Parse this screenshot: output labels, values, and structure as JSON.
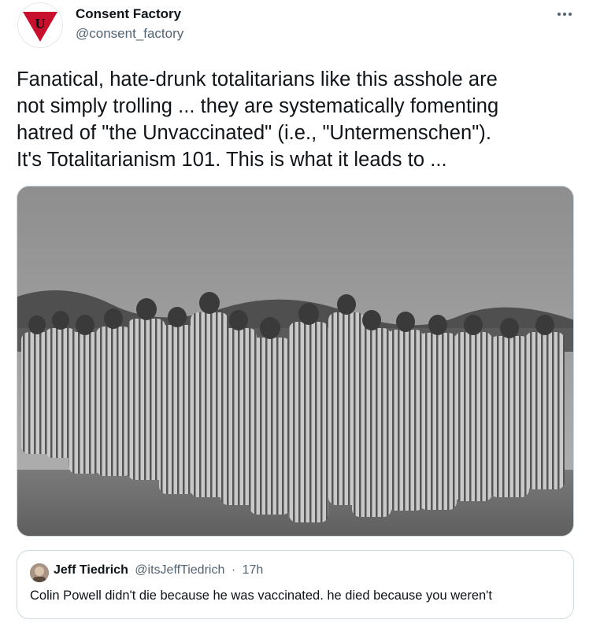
{
  "author": {
    "name": "Consent Factory",
    "handle": "@consent_factory",
    "avatar_letter": "U"
  },
  "tweet": {
    "lines": [
      "Fanatical, hate-drunk totalitarians like this asshole are",
      "not simply trolling ... they are systematically fomenting",
      "hatred of \"the Unvaccinated\" (i.e., \"Untermenschen\").",
      "It's Totalitarianism 101. This is what it leads to ..."
    ]
  },
  "media": {
    "icon": "black-and-white-photo-of-prisoners-in-striped-uniforms"
  },
  "quote": {
    "name": "Jeff Tiedrich",
    "handle": "@itsJeffTiedrich",
    "separator": "·",
    "time": "17h",
    "text": "Colin Powell didn't die because he was vaccinated. he died because you weren't"
  },
  "colors": {
    "text": "#0f1419",
    "secondary": "#536471",
    "border": "#cfd9de",
    "avatar_red": "#c8102e"
  }
}
